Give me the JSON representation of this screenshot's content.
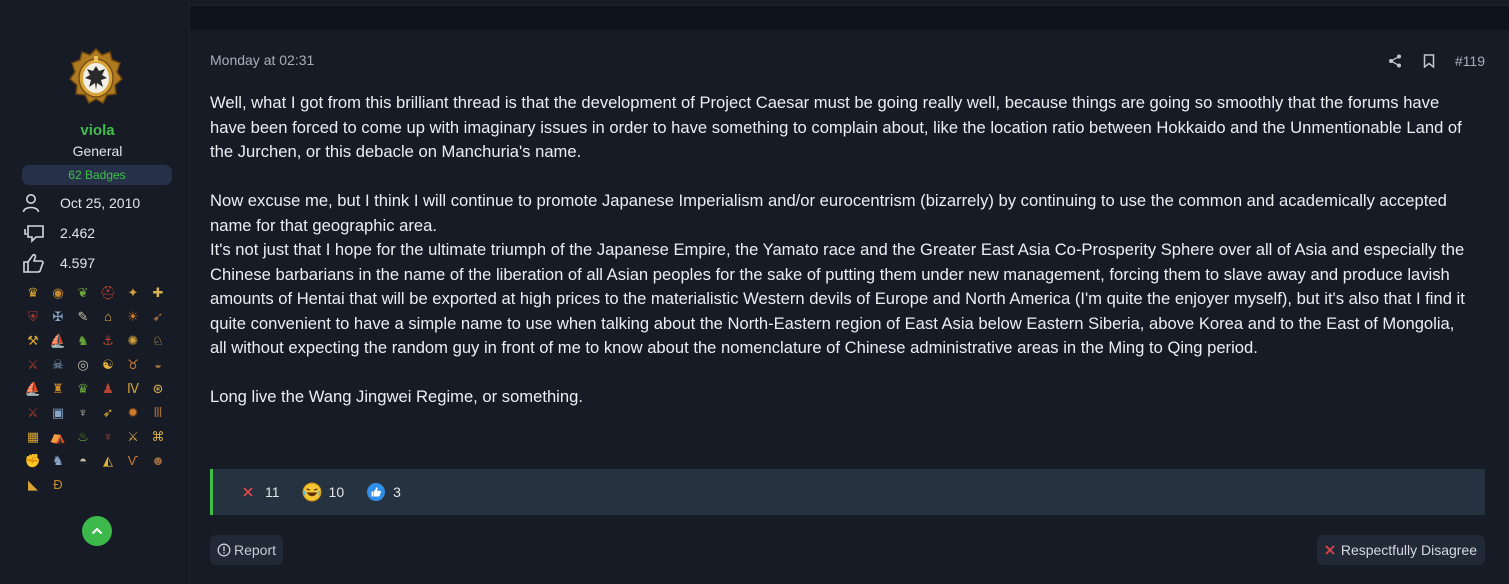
{
  "user": {
    "name": "viola",
    "title": "General",
    "badges_label": "62 Badges",
    "joined": "Oct 25, 2010",
    "messages": "2.462",
    "reaction_score": "4.597",
    "trophy_icons": [
      "crown-icon",
      "medallion-icon",
      "laurel-icon",
      "helmet-icon",
      "runner-icon",
      "cross-icon",
      "shield-icon",
      "cross-shield-icon",
      "feather-icon",
      "temple-icon",
      "sun-icon",
      "cannon-icon",
      "axes-icon",
      "ship-icon",
      "elephant-icon",
      "anchor-icon",
      "compass-icon",
      "horse-icon",
      "crossed-swords-icon",
      "skull-icon",
      "eye-icon",
      "yin-yang-icon",
      "bull-icon",
      "gold-bowl-icon",
      "sail-icon",
      "castle-icon",
      "crowns-icon",
      "samurai-icon",
      "roman-numeral-icon",
      "wheel-icon",
      "sword-icon",
      "chest-icon",
      "dragon-icon",
      "spear-icon",
      "sun-shield-icon",
      "columns-icon",
      "map-icon",
      "camp-icon",
      "treasure-icon",
      "dragon-red-icon",
      "weapons-icon",
      "mosque-icon",
      "fighter-icon",
      "warrior-icon",
      "helmet-red-icon",
      "tent-icon",
      "vf-icon",
      "portrait-icon",
      "africa-icon",
      "dh-icon"
    ]
  },
  "post": {
    "date": "Monday at 02:31",
    "number": "#119",
    "paragraphs": [
      "Well, what I got from this brilliant thread is that the development of Project Caesar must be going really well, because things are going so smoothly that the forums have have been forced to come up with imaginary issues in order to have something to complain about, like the location ratio between Hokkaido and the Unmentionable Land of the Jurchen, or this debacle on Manchuria's name.",
      "",
      "Now excuse me, but I think I will continue to promote Japanese Imperialism and/or eurocentrism (bizarrely) by continuing to use the common and academically accepted name for that geographic area.",
      "It's not just that I hope for the ultimate triumph of the Japanese Empire, the Yamato race and the Greater East Asia Co-Prosperity Sphere over all of Asia and especially the Chinese barbarians in the name of the liberation of all Asian peoples for the sake of putting them under new management, forcing them to slave away and produce lavish amounts of Hentai that will be exported at high prices to the materialistic Western devils of Europe and North America (I'm quite the enjoyer myself), but it's also that I find it quite convenient to have a simple name to use when talking about the North-Eastern region of East Asia below Eastern Siberia, above Korea and to the East of Mongolia, all without expecting the random guy in front of me to know about the nomenclature of Chinese administrative areas in the Ming to Qing period.",
      "",
      "Long live the Wang Jingwei Regime, or something."
    ],
    "reactions": [
      {
        "icon": "disagree-x-icon",
        "count": "11"
      },
      {
        "icon": "laugh-emoji-icon",
        "count": "10"
      },
      {
        "icon": "like-thumb-icon",
        "count": "3"
      }
    ],
    "report_label": "Report",
    "disagree_label": "Respectfully Disagree"
  },
  "colors": {
    "accent_green": "#3fbf4a",
    "background": "#0f131b",
    "panel": "#161b26",
    "reaction_bar": "#263240",
    "disagree_red": "#e0464c"
  }
}
